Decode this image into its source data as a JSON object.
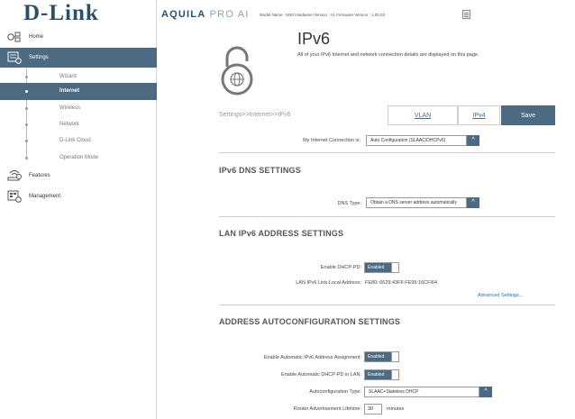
{
  "brand": {
    "logo": "D-Link",
    "product_bold": "AQUILA",
    "product_thin": "PRO AI",
    "accent": "#4c6a82"
  },
  "topbar": {
    "model_info": "Model Name : M30 Hardware Version : A1 Firmware Version : 1.00.02"
  },
  "sidebar": {
    "home": "Home",
    "settings": "Settings",
    "sub_items": [
      "Wizard",
      "Internet",
      "Wireless",
      "Network",
      "D-Link Cloud",
      "Operation Mode"
    ],
    "features": "Features",
    "management": "Management"
  },
  "page": {
    "title": "IPv6",
    "description": "All of your IPv6 Internet and network connection details are displayed on this page.",
    "breadcrumb": "Settings>>Internet>>IPv6",
    "tabs": {
      "vlan": "VLAN",
      "ipv4": "IPv4"
    },
    "save": "Save"
  },
  "connection": {
    "label": "My Internet Connection is:",
    "value": "Auto Configuration (SLAAC/DHCPv6)"
  },
  "dns": {
    "heading": "IPv6 DNS SETTINGS",
    "type_label": "DNS Type:",
    "type_value": "Obtain a DNS server address automatically"
  },
  "lan": {
    "heading": "LAN IPv6 ADDRESS SETTINGS",
    "dhcp_pd_label": "Enable DHCP-PD:",
    "dhcp_pd_value": "Enabled",
    "link_local_label": "LAN IPv6 Link-Local Address:",
    "link_local_value": "FE80::6629:43FF:FE99:16CF/64",
    "advanced": "Advanced Settings..."
  },
  "autoconf": {
    "heading": "ADDRESS AUTOCONFIGURATION SETTINGS",
    "auto_assign_label": "Enable Automatic IPv6 Address Assignment:",
    "auto_assign_value": "Enabled",
    "auto_pd_label": "Enable Automatic DHCP-PD in LAN:",
    "auto_pd_value": "Enabled",
    "type_label": "Autoconfiguration Type:",
    "type_value": "SLAAC+Stateless DHCP",
    "lifetime_label": "Router Advertisement Lifetime:",
    "lifetime_value": "30",
    "lifetime_unit": "minutes"
  }
}
